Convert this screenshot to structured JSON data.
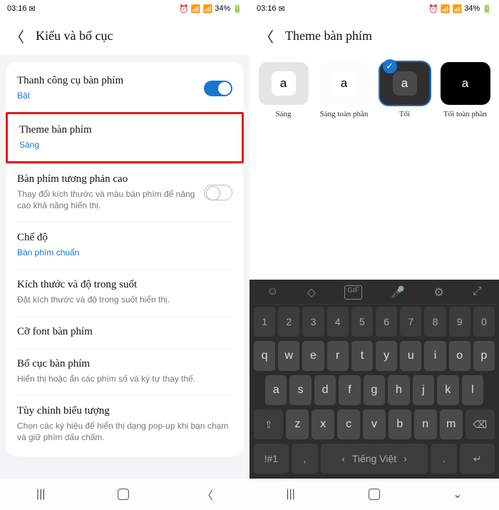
{
  "status": {
    "time": "03:16",
    "battery": "34%"
  },
  "left": {
    "title": "Kiểu và bố cục",
    "items": [
      {
        "title": "Thanh công cụ bàn phím",
        "sub": "Bật",
        "link": true,
        "toggle": "on"
      },
      {
        "title": "Theme bàn phím",
        "sub": "Sáng",
        "link": true,
        "highlight": true
      },
      {
        "title": "Bàn phím tương phản cao",
        "sub": "Thay đổi kích thước và màu bàn phím để nâng cao khả năng hiển thị.",
        "toggle": "off"
      },
      {
        "title": "Chế độ",
        "sub": "Bàn phím chuẩn",
        "link": true
      },
      {
        "title": "Kích thước và độ trong suốt",
        "sub": "Đặt kích thước và độ trong suốt hiển thị."
      },
      {
        "title": "Cỡ font bàn phím"
      },
      {
        "title": "Bố cục bàn phím",
        "sub": "Hiển thị hoặc ẩn các phím số và ký tự thay thế."
      },
      {
        "title": "Tùy chỉnh biểu tượng",
        "sub": "Chọn các ký hiệu để hiển thị dạng pop-up khi bạn chạm và giữ phím dấu chấm."
      }
    ]
  },
  "right": {
    "title": "Theme bàn phím",
    "themes": [
      {
        "label": "Sáng",
        "bg": "#e5e5e5",
        "key": "#fff",
        "fg": "#000"
      },
      {
        "label": "Sáng toàn phần",
        "bg": "#fcfcfc",
        "key": "#fff",
        "fg": "#000"
      },
      {
        "label": "Tối",
        "bg": "#2f2f2f",
        "key": "#4a4a4a",
        "fg": "#fff",
        "selected": true
      },
      {
        "label": "Tối toàn phần",
        "bg": "#000",
        "key": "#000",
        "fg": "#fff"
      }
    ],
    "sample": "a"
  },
  "keyboard": {
    "row_num": [
      "1",
      "2",
      "3",
      "4",
      "5",
      "6",
      "7",
      "8",
      "9",
      "0"
    ],
    "row1": [
      "q",
      "w",
      "e",
      "r",
      "t",
      "y",
      "u",
      "i",
      "o",
      "p"
    ],
    "row2": [
      "a",
      "s",
      "d",
      "f",
      "g",
      "h",
      "j",
      "k",
      "l"
    ],
    "row3": [
      "z",
      "x",
      "c",
      "v",
      "b",
      "n",
      "m"
    ],
    "sym": "!#1",
    "comma": ",",
    "space": "Tiếng Việt",
    "period": "."
  }
}
